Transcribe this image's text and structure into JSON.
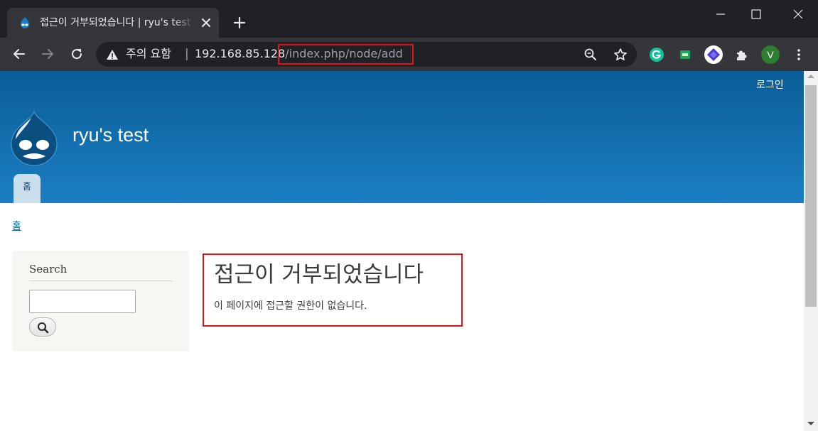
{
  "browser": {
    "tab": {
      "title": "접근이 거부되었습니다 | ryu's test",
      "favicon": "drupal-icon"
    },
    "address_bar": {
      "security_label": "주의 요함",
      "separator": "|",
      "host": "192.168.85.128",
      "path": "/index.php/node/add"
    },
    "extensions": [
      {
        "name": "grammarly-icon",
        "color": "#15c39a",
        "label": "G"
      },
      {
        "name": "green-extension-icon",
        "color": "#1ea362"
      },
      {
        "name": "purple-diamond-extension-icon",
        "color": "#4b3adb"
      },
      {
        "name": "puzzle-icon"
      },
      {
        "name": "profile-avatar",
        "color": "#2e7d32",
        "label": "V"
      }
    ],
    "colors": {
      "titlebar": "#202124",
      "toolbar": "#35363a",
      "highlight_box": "#e0131b"
    }
  },
  "page": {
    "login_link": "로그인",
    "site_name": "ryu's test",
    "primary_nav": [
      "홈"
    ],
    "breadcrumb": "홈",
    "sidebar": {
      "title": "Search",
      "search_value": ""
    },
    "main": {
      "title": "접근이 거부되었습니다",
      "message": "이 페이지에 접근할 권한이 없습니다."
    },
    "colors": {
      "header_top": "#0b5e98",
      "header_bottom": "#1b7ec2",
      "link": "#0b6aa8"
    }
  }
}
